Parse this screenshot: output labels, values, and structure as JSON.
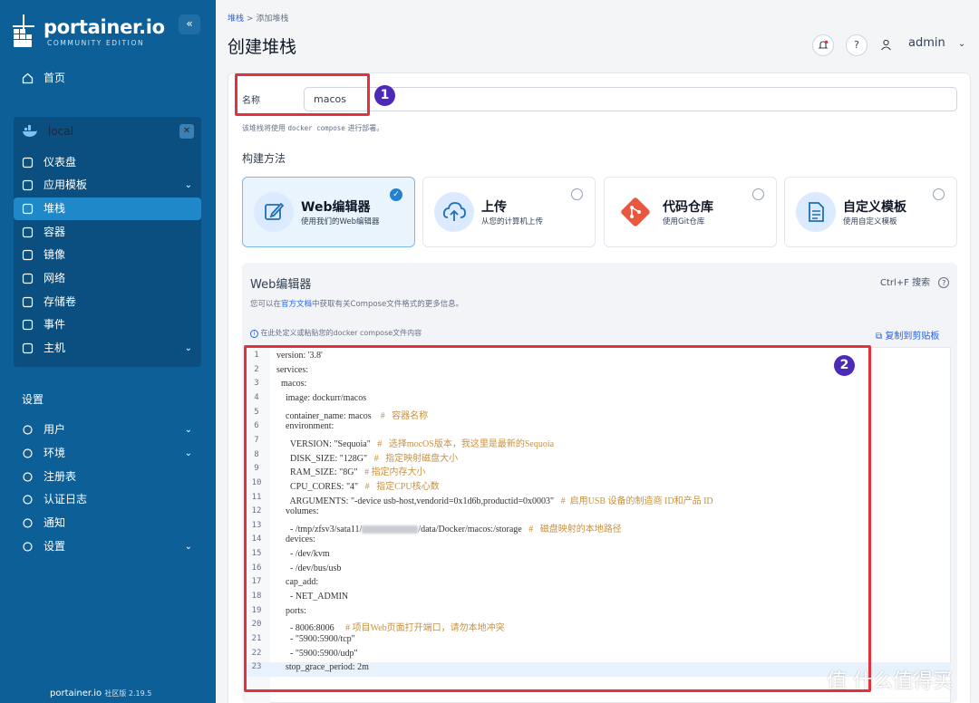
{
  "brand": {
    "name": "portainer.io",
    "edition": "COMMUNITY EDITION",
    "footer_name": "portainer.io",
    "footer_version": "社区版 2.19.5"
  },
  "sidebar": {
    "home": "首页",
    "env_name": "local",
    "env_items": [
      {
        "label": "仪表盘",
        "icon": "dashboard-icon"
      },
      {
        "label": "应用模板",
        "icon": "template-icon"
      },
      {
        "label": "堆栈",
        "icon": "stack-icon"
      },
      {
        "label": "容器",
        "icon": "container-icon"
      },
      {
        "label": "镜像",
        "icon": "image-icon"
      },
      {
        "label": "网络",
        "icon": "network-icon"
      },
      {
        "label": "存储卷",
        "icon": "volume-icon"
      },
      {
        "label": "事件",
        "icon": "event-icon"
      },
      {
        "label": "主机",
        "icon": "host-icon"
      }
    ],
    "settings_title": "设置",
    "settings_items": [
      {
        "label": "用户",
        "icon": "users-icon"
      },
      {
        "label": "环境",
        "icon": "environment-icon"
      },
      {
        "label": "注册表",
        "icon": "registry-icon"
      },
      {
        "label": "认证日志",
        "icon": "auth-log-icon"
      },
      {
        "label": "通知",
        "icon": "bell-icon"
      },
      {
        "label": "设置",
        "icon": "gear-icon"
      }
    ]
  },
  "header": {
    "crumb_parent": "堆栈",
    "crumb_sep": ">",
    "crumb_current": "添加堆栈",
    "title": "创建堆栈",
    "user": "admin"
  },
  "form": {
    "name_label": "名称",
    "name_value": "macos",
    "hint_prefix": "该堆栈将使用",
    "hint_code": "docker compose",
    "hint_suffix": "进行部署。",
    "method_title": "构建方法",
    "methods": [
      {
        "title": "Web编辑器",
        "desc": "使用我们的Web编辑器",
        "selected": true
      },
      {
        "title": "上传",
        "desc": "从您的计算机上传",
        "selected": false
      },
      {
        "title": "代码仓库",
        "desc": "使用Git仓库",
        "selected": false
      },
      {
        "title": "自定义模板",
        "desc": "使用自定义模板",
        "selected": false
      }
    ]
  },
  "editor": {
    "title": "Web编辑器",
    "search": "Ctrl+F 搜索",
    "desc_prefix": "您可以在",
    "desc_link": "官方文档",
    "desc_suffix": "中获取有关Compose文件格式的更多信息。",
    "note": "在此处定义或粘贴您的docker compose文件内容",
    "copy": "复制到剪贴板",
    "lines": [
      {
        "n": "1",
        "code": "version: '3.8'",
        "cm": ""
      },
      {
        "n": "2",
        "code": "services:",
        "cm": ""
      },
      {
        "n": "3",
        "code": "  macos:",
        "cm": ""
      },
      {
        "n": "4",
        "code": "    image: dockurr/macos",
        "cm": ""
      },
      {
        "n": "5",
        "code": "    container_name: macos    ",
        "cm": "#   容器名称"
      },
      {
        "n": "6",
        "code": "    environment:",
        "cm": ""
      },
      {
        "n": "7",
        "code": "      VERSION: \"Sequoia\"   ",
        "cm": "#   选择mocOS版本，我这里是最新的Sequoia"
      },
      {
        "n": "8",
        "code": "      DISK_SIZE: \"128G\"   ",
        "cm": "#   指定映射磁盘大小"
      },
      {
        "n": "9",
        "code": "      RAM_SIZE: \"8G\"   ",
        "cm": "# 指定内存大小"
      },
      {
        "n": "10",
        "code": "      CPU_CORES: \"4\"   ",
        "cm": "#   指定CPU核心数"
      },
      {
        "n": "11",
        "code": "      ARGUMENTS: \"-device usb-host,vendorid=0x1d6b,productid=0x0003\"   ",
        "cm": "#  启用USB 设备的制造商 ID和产品 ID"
      },
      {
        "n": "12",
        "code": "    volumes:",
        "cm": ""
      },
      {
        "n": "13",
        "code": "      - /tmp/zfsv3/sata11/",
        "code2": "/data/Docker/macos:/storage   ",
        "cm": "#   磁盘映射的本地路径"
      },
      {
        "n": "14",
        "code": "    devices:",
        "cm": ""
      },
      {
        "n": "15",
        "code": "      - /dev/kvm",
        "cm": ""
      },
      {
        "n": "16",
        "code": "      - /dev/bus/usb",
        "cm": ""
      },
      {
        "n": "17",
        "code": "    cap_add:",
        "cm": ""
      },
      {
        "n": "18",
        "code": "      - NET_ADMIN",
        "cm": ""
      },
      {
        "n": "19",
        "code": "    ports:",
        "cm": ""
      },
      {
        "n": "20",
        "code": "      - 8006:8006     ",
        "cm": "# 项目Web页面打开端口，请勿本地冲突"
      },
      {
        "n": "21",
        "code": "      - \"5900:5900/tcp\"",
        "cm": ""
      },
      {
        "n": "22",
        "code": "      - \"5900:5900/udp\"",
        "cm": ""
      },
      {
        "n": "23",
        "code": "    stop_grace_period: 2m",
        "cm": ""
      }
    ]
  },
  "annotations": {
    "badge1": "1",
    "badge2": "2"
  },
  "watermark": "值 什么值得买",
  "colors": {
    "sidebar": "#0d5f97",
    "accent": "#2481cf",
    "annotation_red": "#e3323c",
    "badge": "#4c2ab8"
  }
}
